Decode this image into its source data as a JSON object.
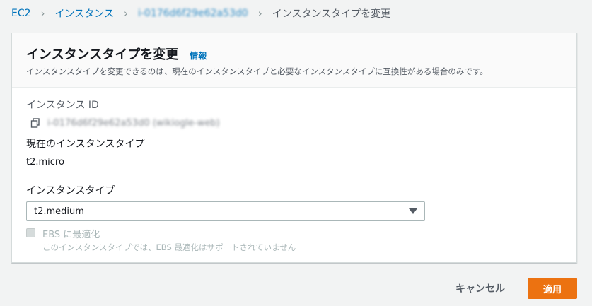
{
  "breadcrumb": {
    "items": [
      "EC2",
      "インスタンス",
      "i-0176d6f29e62a53d0",
      "インスタンスタイプを変更"
    ]
  },
  "card": {
    "title": "インスタンスタイプを変更",
    "info_link": "情報",
    "description": "インスタンスタイプを変更できるのは、現在のインスタンスタイプと必要なインスタンスタイプに互換性がある場合のみです。"
  },
  "instance": {
    "id_label": "インスタンス ID",
    "id_value": "i-0176d6f29e62a53d0 (wikiogle-web)",
    "current_type_label": "現在のインスタンスタイプ",
    "current_type_value": "t2.micro"
  },
  "instance_type": {
    "label": "インスタンスタイプ",
    "selected": "t2.medium"
  },
  "ebs": {
    "label": "EBS に最適化",
    "description": "このインスタンスタイプでは、EBS 最適化はサポートされていません",
    "checked": false,
    "disabled": true
  },
  "footer": {
    "cancel_label": "キャンセル",
    "apply_label": "適用"
  },
  "colors": {
    "primary": "#ec7211",
    "link": "#0073bb",
    "background": "#f2f3f3"
  }
}
